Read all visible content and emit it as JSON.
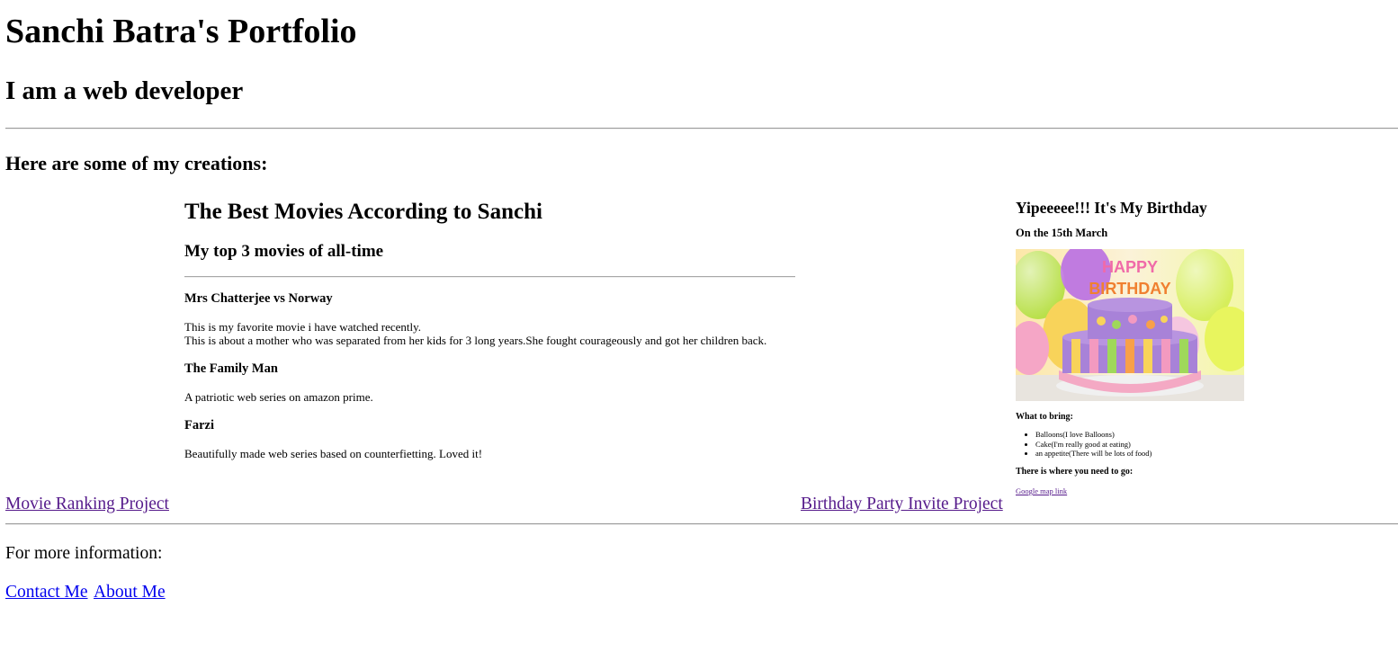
{
  "header": {
    "title": "Sanchi Batra's Portfolio",
    "subtitle": "I am a web developer"
  },
  "creations": {
    "heading": "Here are some of my creations:"
  },
  "movie_project": {
    "title": "The Best Movies According to Sanchi",
    "subtitle": "My top 3 movies of all-time",
    "movies": [
      {
        "name": "Mrs Chatterjee vs Norway",
        "lines": [
          "This is my favorite movie i have watched recently.",
          "This is about a mother who was separated from her kids for 3 long years.She fought courageously and got her children back."
        ]
      },
      {
        "name": "The Family Man",
        "lines": [
          "A patriotic web series on amazon prime."
        ]
      },
      {
        "name": "Farzi",
        "lines": [
          "Beautifully made web series based on counterfietting. Loved it!"
        ]
      }
    ],
    "link_label": "Movie Ranking Project"
  },
  "birthday_project": {
    "title": "Yipeeeee!!! It's My Birthday",
    "date": "On the 15th March",
    "cake_text_top": "HAPPY",
    "cake_text_bottom": "BIRTHDAY",
    "bring_heading": "What to bring:",
    "bring_items": [
      "Balloons(I love Balloons)",
      "Cake(I'm really good at eating)",
      "an appetite(There will be lots of food)"
    ],
    "where_heading": "There is where you need to go:",
    "map_link": "Google map link",
    "link_label": "Birthday Party Invite Project"
  },
  "footer": {
    "more_info": "For more information:",
    "contact_label": "Contact Me",
    "about_label": "About Me"
  },
  "colors": {
    "visited_link": "#551a8b",
    "link": "#0000ee"
  }
}
